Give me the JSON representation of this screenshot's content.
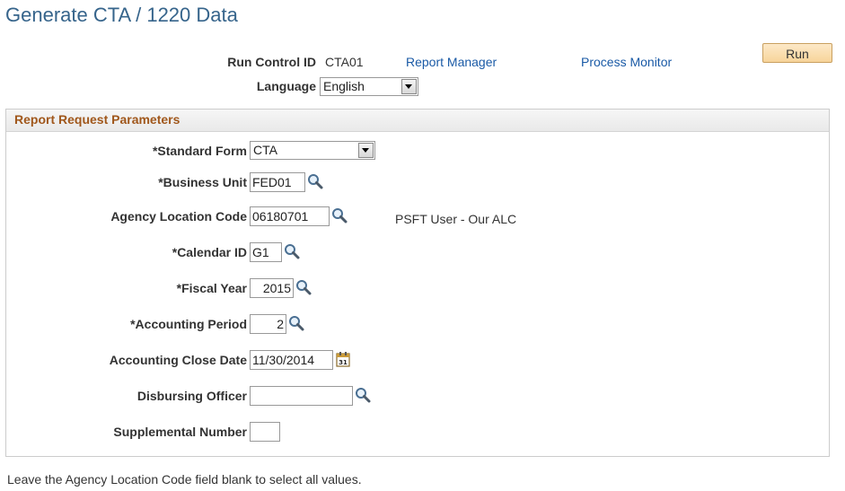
{
  "page": {
    "title": "Generate CTA / 1220 Data"
  },
  "run_control": {
    "label": "Run Control ID",
    "value": "CTA01",
    "report_manager": "Report Manager",
    "process_monitor": "Process Monitor",
    "run_button": "Run",
    "language_label": "Language",
    "language_value": "English"
  },
  "panel": {
    "title": "Report Request Parameters",
    "standard_form": {
      "label": "*Standard Form",
      "value": "CTA"
    },
    "business_unit": {
      "label": "*Business Unit",
      "value": "FED01"
    },
    "agency_location_code": {
      "label": "Agency Location Code",
      "value": "06180701",
      "description": "PSFT User - Our ALC"
    },
    "calendar_id": {
      "label": "*Calendar ID",
      "value": "G1"
    },
    "fiscal_year": {
      "label": "*Fiscal Year",
      "value": "2015"
    },
    "accounting_period": {
      "label": "*Accounting Period",
      "value": "2"
    },
    "accounting_close_date": {
      "label": "Accounting Close Date",
      "value": "11/30/2014"
    },
    "disbursing_officer": {
      "label": "Disbursing Officer",
      "value": ""
    },
    "supplemental_number": {
      "label": "Supplemental Number",
      "value": ""
    }
  },
  "footer": {
    "note": "Leave the Agency Location Code field blank to select all values."
  },
  "colors": {
    "title": "#36648b",
    "link": "#1a5aa6",
    "section_title": "#a0571b",
    "run_button": "#f7d49a"
  },
  "icons": {
    "lookup": "magnifier-lookup-icon",
    "calendar": "calendar-icon",
    "dropdown": "chevron-down-icon"
  }
}
